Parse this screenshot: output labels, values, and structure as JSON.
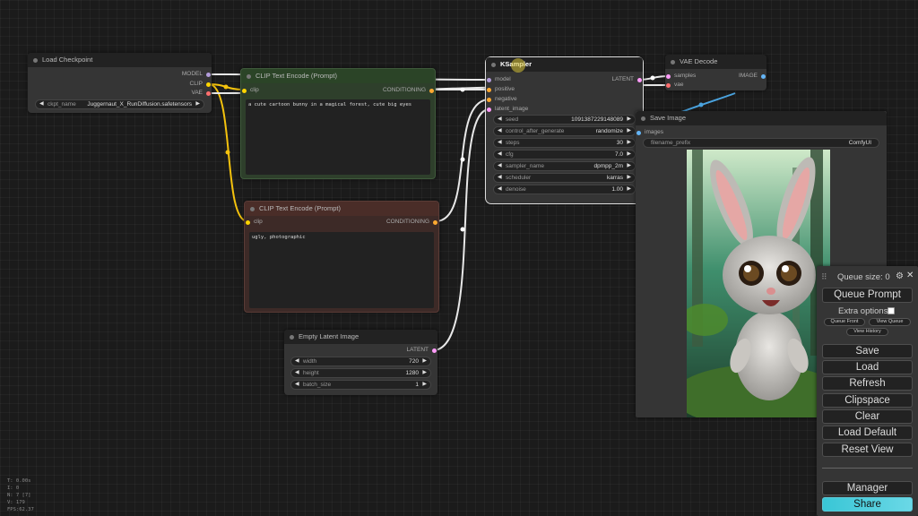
{
  "nodes": {
    "load_checkpoint": {
      "title": "Load Checkpoint",
      "outputs": [
        "MODEL",
        "CLIP",
        "VAE"
      ],
      "widget": {
        "name": "ckpt_name",
        "value": "Juggernaut_X_RunDiffusion.safetensors"
      }
    },
    "clip_positive": {
      "title": "CLIP Text Encode (Prompt)",
      "input": "clip",
      "output": "CONDITIONING",
      "text": "a cute cartoon bunny in a magical forest, cute big eyes"
    },
    "clip_negative": {
      "title": "CLIP Text Encode (Prompt)",
      "input": "clip",
      "output": "CONDITIONING",
      "text": "ugly, photographic"
    },
    "empty_latent": {
      "title": "Empty Latent Image",
      "output": "LATENT",
      "widgets": [
        {
          "name": "width",
          "value": "720"
        },
        {
          "name": "height",
          "value": "1280"
        },
        {
          "name": "batch_size",
          "value": "1"
        }
      ]
    },
    "ksampler": {
      "title": "KSampler",
      "inputs": [
        "model",
        "positive",
        "negative",
        "latent_image"
      ],
      "output": "LATENT",
      "widgets": [
        {
          "name": "seed",
          "value": "1091387229148089"
        },
        {
          "name": "control_after_generate",
          "value": "randomize"
        },
        {
          "name": "steps",
          "value": "30"
        },
        {
          "name": "cfg",
          "value": "7.0"
        },
        {
          "name": "sampler_name",
          "value": "dpmpp_2m"
        },
        {
          "name": "scheduler",
          "value": "karras"
        },
        {
          "name": "denoise",
          "value": "1.00"
        }
      ]
    },
    "vae_decode": {
      "title": "VAE Decode",
      "inputs": [
        "samples",
        "vae"
      ],
      "output": "IMAGE"
    },
    "save_image": {
      "title": "Save Image",
      "input": "images",
      "widget": {
        "name": "filename_prefix",
        "value": "ComfyUI"
      }
    }
  },
  "queue_panel": {
    "queue_size": "Queue size: 0",
    "queue_prompt": "Queue Prompt",
    "extra_options": "Extra options",
    "queue_front": "Queue Front",
    "view_queue": "View Queue",
    "view_history": "View History",
    "save": "Save",
    "load": "Load",
    "refresh": "Refresh",
    "clipspace": "Clipspace",
    "clear": "Clear",
    "load_default": "Load Default",
    "reset_view": "Reset View",
    "manager": "Manager",
    "share": "Share"
  },
  "stats": [
    "T: 0.00s",
    "I: 0",
    "N: 7 [7]",
    "V: 179",
    "FPS:62.37"
  ],
  "colors": {
    "model": "#b39ddb",
    "clip": "#ffd500",
    "vae": "#ff6e6e",
    "conditioning": "#ffa931",
    "latent": "#ff9cf9",
    "image": "#64b5f6",
    "positive_node": "#2b3a29",
    "negative_node": "#3d2a27",
    "share_gradient": "#4fd1e8"
  }
}
